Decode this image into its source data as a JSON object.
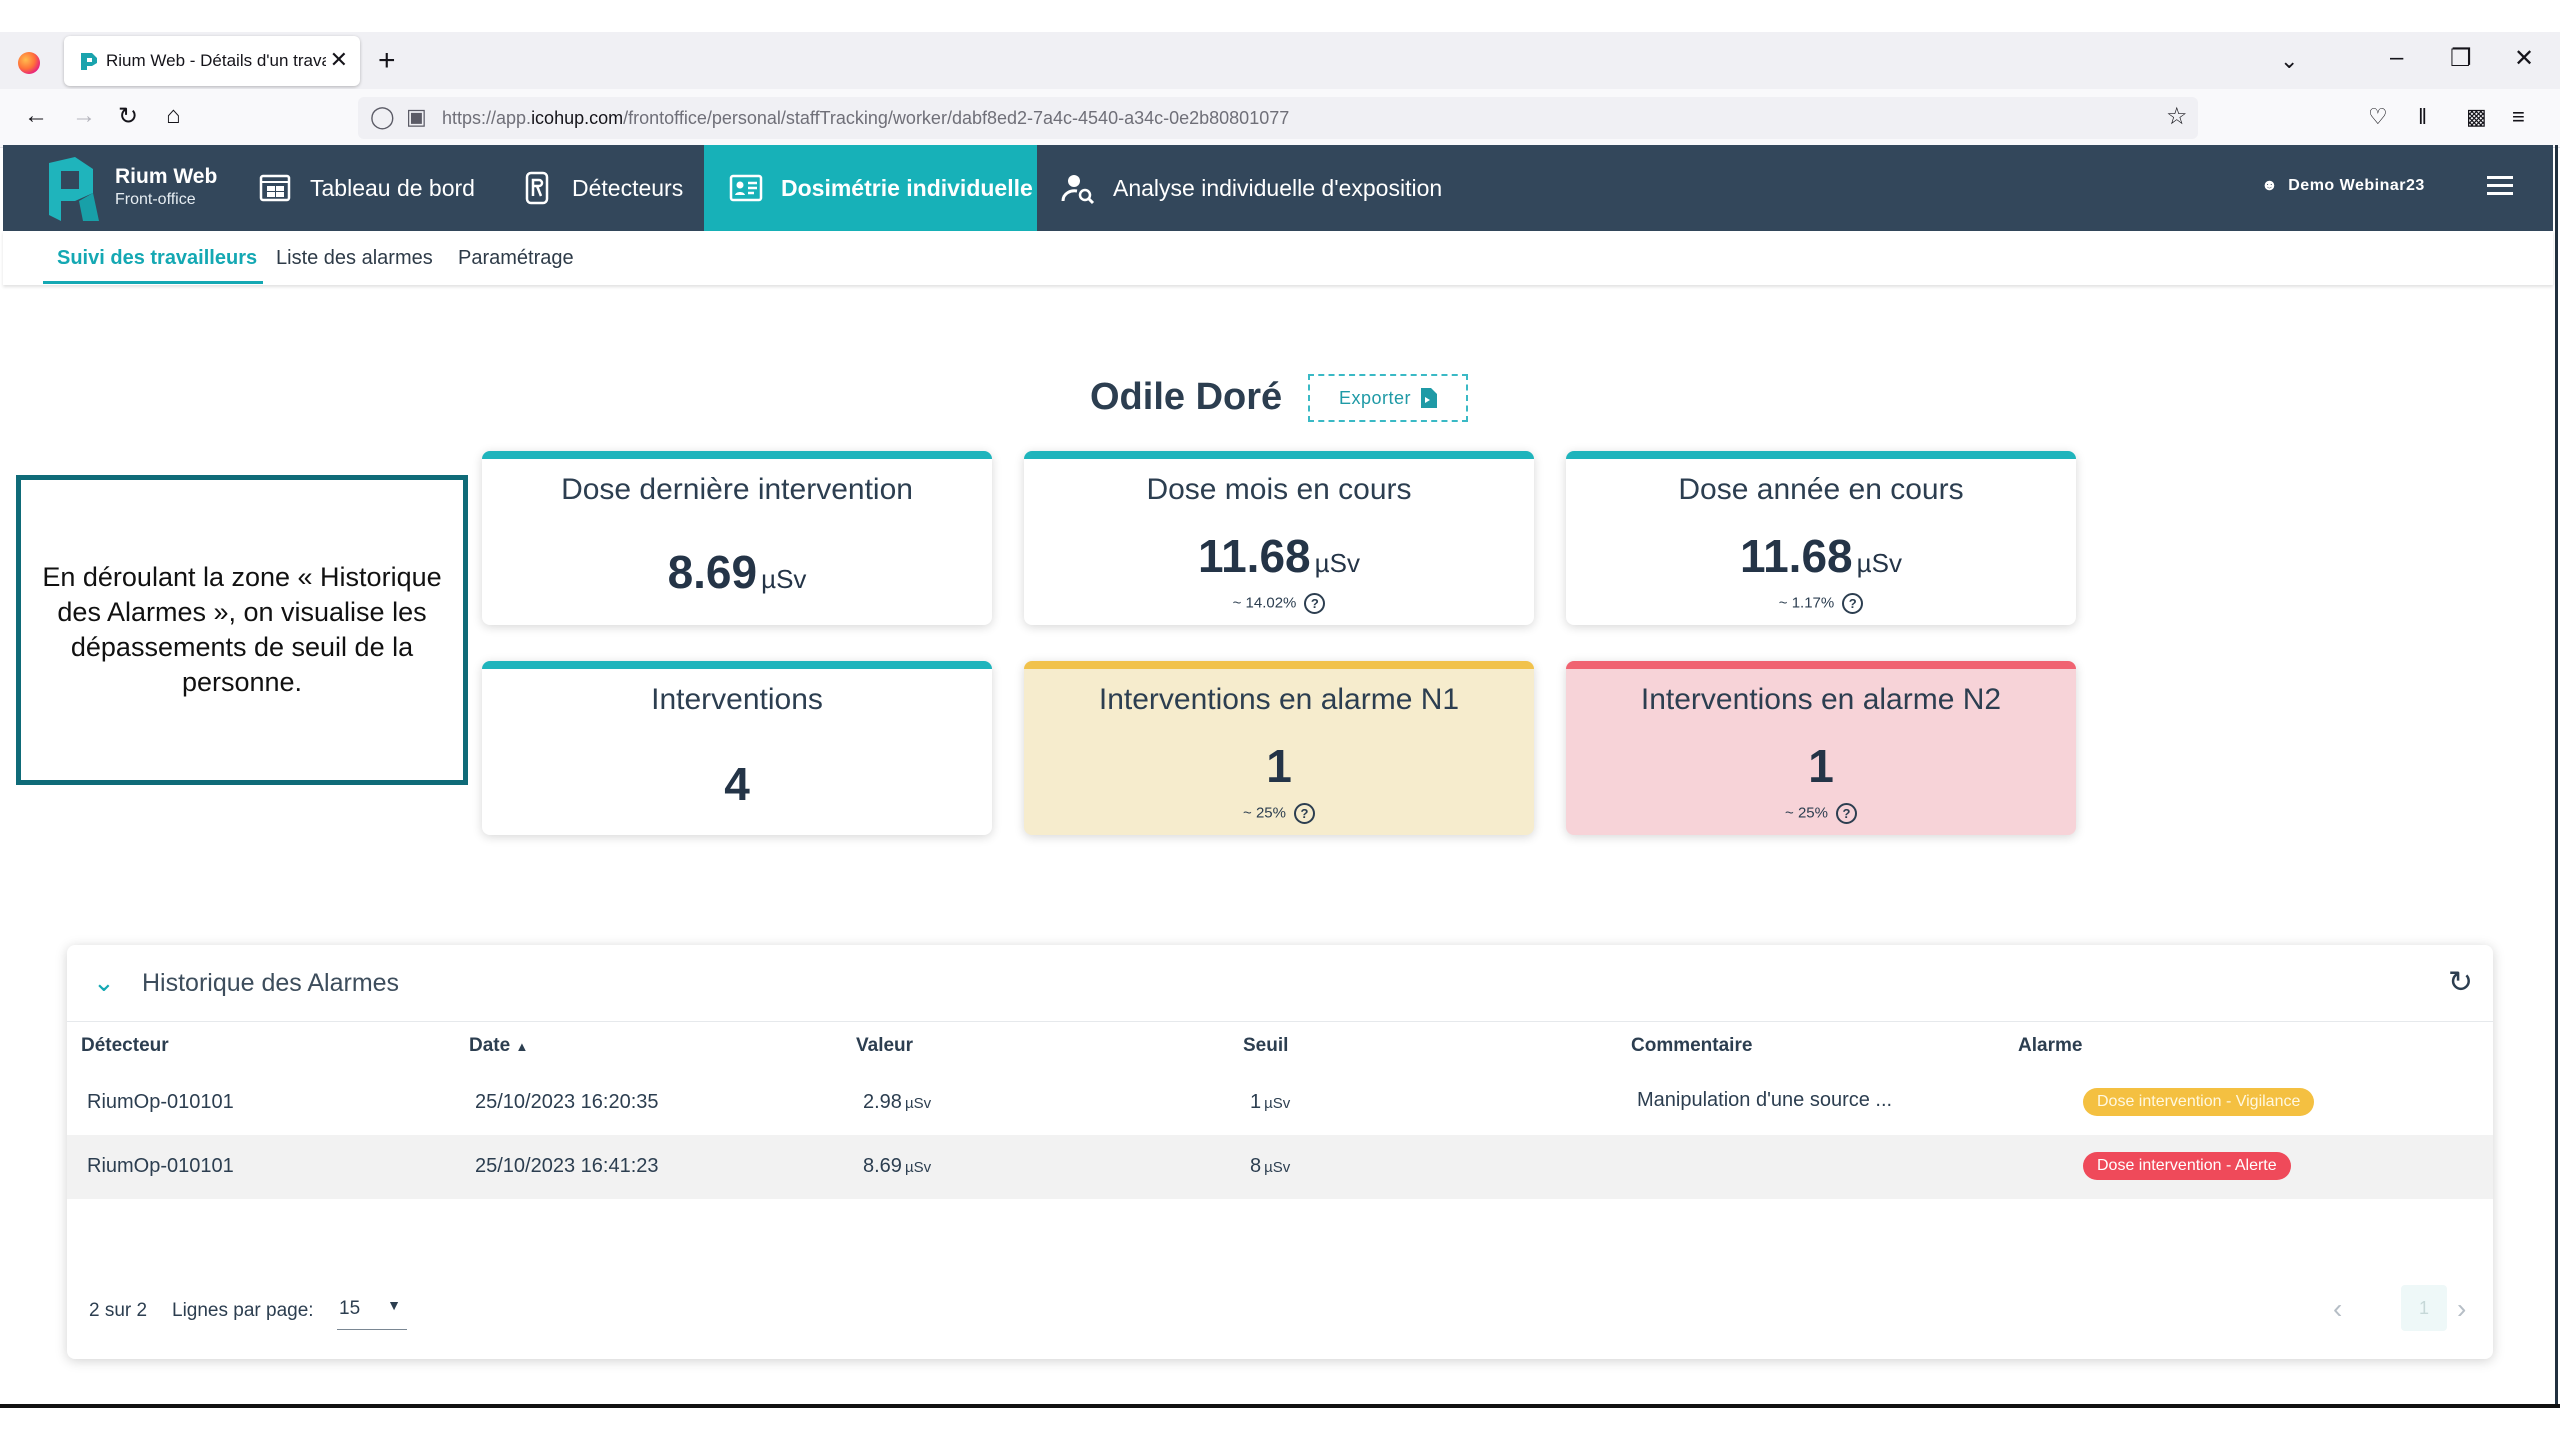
{
  "browser": {
    "tab_title": "Rium Web - Détails d'un travail",
    "tab_close": "✕",
    "new_tab": "+",
    "url_prefix": "https://app.",
    "url_domain": "icohup.com",
    "url_path": "/frontoffice/personal/staffTracking/worker/dabf8ed2-7a4c-4540-a34c-0e2b80801077"
  },
  "app": {
    "logo_title": "Rium Web",
    "logo_subtitle": "Front-office",
    "menu": [
      {
        "label": "Tableau de bord",
        "icon": "dashboard-icon"
      },
      {
        "label": "Détecteurs",
        "icon": "detector-icon"
      },
      {
        "label": "Dosimétrie individuelle",
        "icon": "badge-id-icon",
        "active": true
      },
      {
        "label": "Analyse individuelle d'exposition",
        "icon": "person-search-icon"
      }
    ],
    "user": "Demo Webinar23",
    "subnav": [
      "Suivi des travailleurs",
      "Liste des alarmes",
      "Paramétrage"
    ],
    "colors": {
      "header": "#33475b",
      "accent": "#17b1b8",
      "warning": "#f1c24c",
      "danger": "#f06371"
    }
  },
  "worker": {
    "name": "Odile Doré",
    "export_label": "Exporter"
  },
  "callout_text": "En déroulant la zone « Historique des Alarmes », on visualise les dépassements de seuil de la personne.",
  "cards": [
    {
      "title": "Dose dernière intervention",
      "value": "8.69",
      "unit": "µSv"
    },
    {
      "title": "Dose mois en cours",
      "value": "11.68",
      "unit": "µSv",
      "sub": "~ 14.02%"
    },
    {
      "title": "Dose année en cours",
      "value": "11.68",
      "unit": "µSv",
      "sub": "~ 1.17%"
    },
    {
      "title": "Interventions",
      "value": "4"
    },
    {
      "title": "Interventions en alarme N1",
      "value": "1",
      "sub": "~ 25%"
    },
    {
      "title": "Interventions en alarme N2",
      "value": "1",
      "sub": "~ 25%"
    }
  ],
  "history": {
    "title": "Historique des Alarmes",
    "columns": [
      "Détecteur",
      "Date",
      "Valeur",
      "Seuil",
      "Commentaire",
      "Alarme"
    ],
    "sort_arrow": "▲",
    "rows": [
      {
        "detector": "RiumOp-010101",
        "date": "25/10/2023 16:20:35",
        "value": "2.98",
        "value_unit": "µSv",
        "threshold": "1",
        "threshold_unit": "µSv",
        "comment": "Manipulation d'une source ...",
        "alarm": "Dose intervention - Vigilance"
      },
      {
        "detector": "RiumOp-010101",
        "date": "25/10/2023 16:41:23",
        "value": "8.69",
        "value_unit": "µSv",
        "threshold": "8",
        "threshold_unit": "µSv",
        "comment": "",
        "alarm": "Dose intervention - Alerte"
      }
    ],
    "count": "2 sur 2",
    "rows_per_page_label": "Lignes par page:",
    "rows_per_page": "15",
    "current_page": "1"
  }
}
